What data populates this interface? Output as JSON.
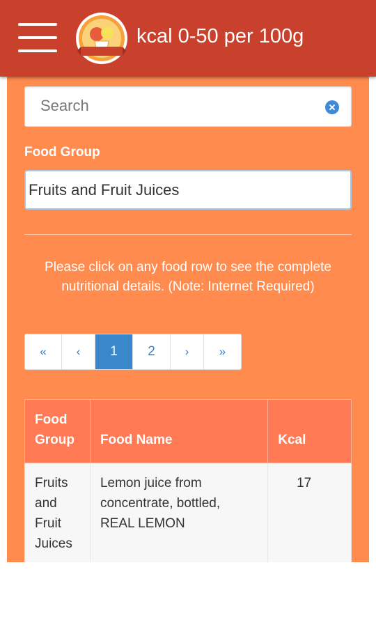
{
  "appbar": {
    "title": "kcal 0-50 per 100g",
    "logo_text": "CALORIES",
    "menu_icon": "hamburger-menu-icon"
  },
  "search": {
    "placeholder": "Search",
    "value": "",
    "clear_icon": "clear-circle-icon"
  },
  "food_group": {
    "label": "Food Group",
    "selected": "Fruits and Fruit Juices"
  },
  "notice": "Please click on any food row to see the complete nutritional details. (Note: Internet Required)",
  "pagination": {
    "first": "«",
    "prev": "‹",
    "pages": [
      "1",
      "2"
    ],
    "current": "1",
    "next": "›",
    "last": "»"
  },
  "table": {
    "headers": [
      "Food Group",
      "Food Name",
      "Kcal"
    ],
    "rows": [
      {
        "group": "Fruits and Fruit Juices",
        "name": "Lemon juice from concentrate, bottled, REAL LEMON",
        "kcal": "17"
      }
    ]
  },
  "colors": {
    "appbar": "#c9402c",
    "content_bg": "#ff8b4e",
    "table_header": "#ff7a55",
    "active_page": "#3a87cc"
  }
}
